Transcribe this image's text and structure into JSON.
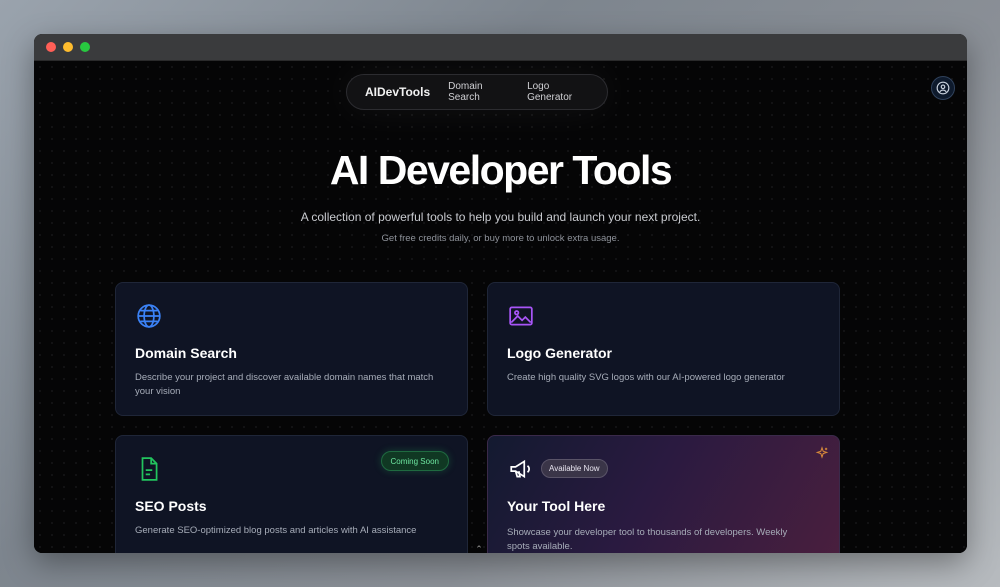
{
  "nav": {
    "brand": "AIDevTools",
    "links": [
      "Domain Search",
      "Logo Generator"
    ]
  },
  "hero": {
    "title": "AI Developer Tools",
    "subtitle": "A collection of powerful tools to help you build and launch your next project.",
    "note": "Get free credits daily, or buy more to unlock extra usage."
  },
  "cards": [
    {
      "icon": "globe-icon",
      "title": "Domain Search",
      "description": "Describe your project and discover available domain names that match your vision"
    },
    {
      "icon": "image-icon",
      "title": "Logo Generator",
      "description": "Create high quality SVG logos with our AI-powered logo generator"
    },
    {
      "icon": "document-icon",
      "title": "SEO Posts",
      "description": "Generate SEO-optimized blog posts and articles with AI assistance",
      "badge": "Coming Soon"
    },
    {
      "icon": "megaphone-icon",
      "title": "Your Tool Here",
      "description": "Showcase your developer tool to thousands of developers. Weekly spots available.",
      "badge": "Available Now"
    }
  ],
  "colors": {
    "globe": "#3b82f6",
    "image": "#a855f7",
    "document": "#22c55e",
    "sparkle": "#d98a3a"
  }
}
